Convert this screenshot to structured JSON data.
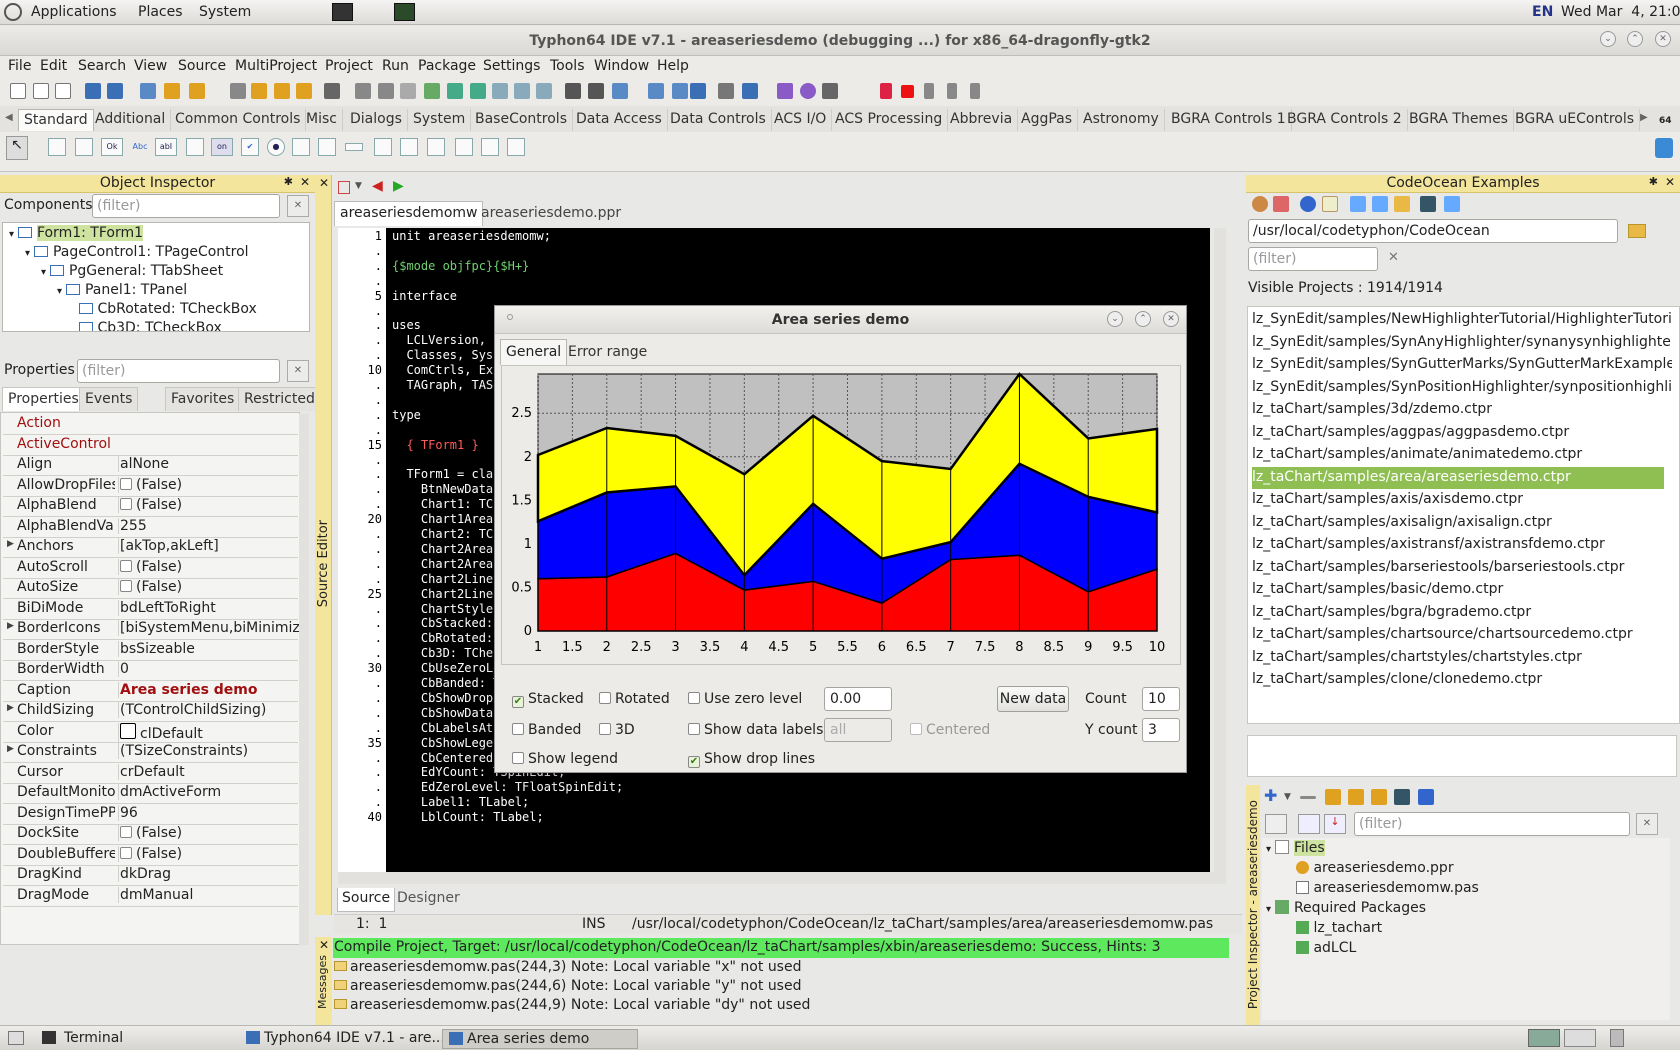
{
  "panel": {
    "menus": [
      "Applications",
      "Places",
      "System"
    ],
    "lang": "EN",
    "clock": "Wed Mar  4, 21:03"
  },
  "window": {
    "title": "Typhon64 IDE v7.1 - areaseriesdemo (debugging ...) for x86_64-dragonfly-gtk2"
  },
  "menu": [
    "File",
    "Edit",
    "Search",
    "View",
    "Source",
    "MultiProject",
    "Project",
    "Run",
    "Package",
    "Settings",
    "Tools",
    "Window",
    "Help"
  ],
  "component_tabs": [
    "Standard",
    "Additional",
    "Common Controls",
    "Misc",
    "Dialogs",
    "System",
    "BaseControls",
    "Data Access",
    "Data Controls",
    "ACS I/O",
    "ACS Processing",
    "Abbrevia",
    "AggPas",
    "Astronomy",
    "BGRA Controls 1",
    "BGRA Controls 2",
    "BGRA Themes",
    "BGRA uEControls"
  ],
  "component_icon_labels": [
    "Ok",
    "Abc",
    "abI",
    "on"
  ],
  "right_toolbar_number": "64",
  "object_inspector": {
    "title": "Object Inspector",
    "components_label": "Components",
    "filter_placeholder": "(filter)",
    "tree": [
      "Form1: TForm1",
      "PageControl1: TPageControl",
      "PgGeneral: TTabSheet",
      "Panel1: TPanel",
      "CbRotated: TCheckBox",
      "Cb3D: TCheckBox"
    ],
    "properties_label": "Properties",
    "tabs": [
      "Properties",
      "Events",
      "Favorites",
      "Restricted"
    ],
    "props": [
      {
        "n": "Action",
        "v": "",
        "red": true
      },
      {
        "n": "ActiveControl",
        "v": "",
        "red": true
      },
      {
        "n": "Align",
        "v": "alNone"
      },
      {
        "n": "AllowDropFiles",
        "v": "(False)",
        "cb": true
      },
      {
        "n": "AlphaBlend",
        "v": "(False)",
        "cb": true
      },
      {
        "n": "AlphaBlendValue",
        "v": "255"
      },
      {
        "n": "Anchors",
        "v": "[akTop,akLeft]",
        "exp": true
      },
      {
        "n": "AutoScroll",
        "v": "(False)",
        "cb": true
      },
      {
        "n": "AutoSize",
        "v": "(False)",
        "cb": true
      },
      {
        "n": "BiDiMode",
        "v": "bdLeftToRight"
      },
      {
        "n": "BorderIcons",
        "v": "[biSystemMenu,biMinimize,",
        "exp": true
      },
      {
        "n": "BorderStyle",
        "v": "bsSizeable"
      },
      {
        "n": "BorderWidth",
        "v": "0"
      },
      {
        "n": "Caption",
        "v": "Area series demo",
        "bold": true
      },
      {
        "n": "ChildSizing",
        "v": "(TControlChildSizing)",
        "exp": true
      },
      {
        "n": "Color",
        "v": "clDefault",
        "sw": true
      },
      {
        "n": "Constraints",
        "v": "(TSizeConstraints)",
        "exp": true
      },
      {
        "n": "Cursor",
        "v": "crDefault"
      },
      {
        "n": "DefaultMonitor",
        "v": "dmActiveForm"
      },
      {
        "n": "DesignTimePPI",
        "v": "96"
      },
      {
        "n": "DockSite",
        "v": "(False)",
        "cb": true
      },
      {
        "n": "DoubleBuffered",
        "v": "(False)",
        "cb": true
      },
      {
        "n": "DragKind",
        "v": "dkDrag"
      },
      {
        "n": "DragMode",
        "v": "dmManual"
      }
    ]
  },
  "editor": {
    "vertical_label": "Source Editor",
    "tabs": [
      "areaseriesdemomw",
      "areaseriesdemo.ppr"
    ],
    "gutter": [
      "1",
      ".",
      ".",
      ".",
      "5",
      ".",
      ".",
      ".",
      ".",
      "10",
      ".",
      ".",
      ".",
      ".",
      "15",
      ".",
      ".",
      ".",
      ".",
      "20",
      ".",
      ".",
      ".",
      ".",
      "25",
      ".",
      ".",
      ".",
      ".",
      "30",
      ".",
      ".",
      ".",
      ".",
      "35",
      ".",
      ".",
      ".",
      ".",
      "40"
    ],
    "lines": [
      {
        "t": "unit areaseriesdemomw;",
        "c": "#ffffff"
      },
      {
        "t": "",
        "c": "#ffffff"
      },
      {
        "t": "{$mode objfpc}{$H+}",
        "c": "#6fd16f"
      },
      {
        "t": "",
        "c": "#ffffff"
      },
      {
        "t": "interface",
        "c": "#ffffff"
      },
      {
        "t": "",
        "c": "#ffffff"
      },
      {
        "t": "uses",
        "c": "#ffffff"
      },
      {
        "t": "  LCLVersion,",
        "c": "#ffffff"
      },
      {
        "t": "  Classes, SysU",
        "c": "#ffffff"
      },
      {
        "t": "  ComCtrls, Ext",
        "c": "#ffffff"
      },
      {
        "t": "  TAGraph, TASe",
        "c": "#ffffff"
      },
      {
        "t": "",
        "c": "#ffffff"
      },
      {
        "t": "type",
        "c": "#ffffff"
      },
      {
        "t": "",
        "c": "#ffffff"
      },
      {
        "t": "  { TForm1 }",
        "c": "#ff5a5a"
      },
      {
        "t": "",
        "c": "#ffffff"
      },
      {
        "t": "  TForm1 = clas",
        "c": "#ffffff"
      },
      {
        "t": "    BtnNewData:",
        "c": "#ffffff"
      },
      {
        "t": "    Chart1: TCh",
        "c": "#ffffff"
      },
      {
        "t": "    Chart1AreaS",
        "c": "#ffffff"
      },
      {
        "t": "    Chart2: TCh",
        "c": "#ffffff"
      },
      {
        "t": "    Chart2AreaS",
        "c": "#ffffff"
      },
      {
        "t": "    Chart2AreaS",
        "c": "#ffffff"
      },
      {
        "t": "    Chart2LineS",
        "c": "#ffffff"
      },
      {
        "t": "    Chart2LineS",
        "c": "#ffffff"
      },
      {
        "t": "    ChartStyles",
        "c": "#ffffff"
      },
      {
        "t": "    CbStacked:",
        "c": "#ffffff"
      },
      {
        "t": "    CbRotated:",
        "c": "#ffffff"
      },
      {
        "t": "    Cb3D: TChec",
        "c": "#ffffff"
      },
      {
        "t": "    CbUseZeroLe",
        "c": "#ffffff"
      },
      {
        "t": "    CbBanded: T",
        "c": "#ffffff"
      },
      {
        "t": "    CbShowDropL",
        "c": "#ffffff"
      },
      {
        "t": "    CbShowDataL",
        "c": "#ffffff"
      },
      {
        "t": "    CbLabelsAt:",
        "c": "#ffffff"
      },
      {
        "t": "    CbShowLegend: TCheckBox;",
        "c": "#ffffff"
      },
      {
        "t": "    CbCentered: TCheckBox;",
        "c": "#ffffff"
      },
      {
        "t": "    EdYCount: TSpinEdit;",
        "c": "#ffffff"
      },
      {
        "t": "    EdZeroLevel: TFloatSpinEdit;",
        "c": "#ffffff"
      },
      {
        "t": "    Label1: TLabel;",
        "c": "#ffffff"
      },
      {
        "t": "    LblCount: TLabel;",
        "c": "#ffffff"
      }
    ],
    "bottom_tabs": [
      "Source",
      "Designer"
    ],
    "status": {
      "pos": "1:  1",
      "mode": "INS",
      "file": "/usr/local/codetyphon/CodeOcean/lz_taChart/samples/area/areaseriesdemomw.pas"
    }
  },
  "messages": {
    "vertical_label": "Messages",
    "compile": "Compile Project, Target: /usr/local/codetyphon/CodeOcean/lz_taChart/samples/xbin/areaseriesdemo: Success, Hints: 3",
    "notes": [
      "areaseriesdemomw.pas(244,3) Note: Local variable \"x\" not used",
      "areaseriesdemomw.pas(244,6) Note: Local variable \"y\" not used",
      "areaseriesdemomw.pas(244,9) Note: Local variable \"dy\" not used"
    ]
  },
  "dialog": {
    "title": "Area series demo",
    "tabs": [
      "General",
      "Error range"
    ],
    "controls": {
      "stacked": "Stacked",
      "rotated": "Rotated",
      "use_zero_level": "Use zero level",
      "zero_level": "0.00",
      "new_data": "New data",
      "count_label": "Count",
      "count": "10",
      "banded": "Banded",
      "three_d": "3D",
      "show_data_labels": "Show data labels",
      "labels_select": "all",
      "centered": "Centered",
      "ycount_label": "Y count",
      "ycount": "3",
      "show_legend": "Show legend",
      "show_drop_lines": "Show drop lines"
    }
  },
  "chart_data": {
    "type": "area",
    "stacked": true,
    "x": [
      1,
      2,
      3,
      4,
      5,
      6,
      7,
      8,
      9,
      10
    ],
    "xticks": [
      "1",
      "1.5",
      "2",
      "2.5",
      "3",
      "3.5",
      "4",
      "4.5",
      "5",
      "5.5",
      "6",
      "6.5",
      "7",
      "7.5",
      "8",
      "8.5",
      "9",
      "9.5",
      "10"
    ],
    "yticks": [
      "0",
      "0.5",
      "1",
      "1.5",
      "2",
      "2.5"
    ],
    "ylim": [
      0,
      2.95
    ],
    "xlim": [
      1,
      10
    ],
    "grid": true,
    "series": [
      {
        "values": [
          0.6,
          0.62,
          0.89,
          0.47,
          0.57,
          0.32,
          0.82,
          0.87,
          0.45,
          0.71
        ],
        "color": "#ff0000"
      },
      {
        "values": [
          0.66,
          0.97,
          0.77,
          0.17,
          0.89,
          0.51,
          0.2,
          1.05,
          1.09,
          0.65
        ],
        "color": "#0000ff"
      },
      {
        "values": [
          0.76,
          0.74,
          0.58,
          1.16,
          1.01,
          1.12,
          0.84,
          1.03,
          0.67,
          0.96
        ],
        "color": "#ffff00"
      }
    ]
  },
  "codeocean": {
    "title": "CodeOcean Examples",
    "path": "/usr/local/codetyphon/CodeOcean",
    "filter_placeholder": "(filter)",
    "visible": "Visible Projects : 1914/1914",
    "items": [
      "lz_SynEdit/samples/NewHighlighterTutorial/HighlighterTutorial.ctpr",
      "lz_SynEdit/samples/SynAnyHighlighter/synanysynhighlighter.ctpr",
      "lz_SynEdit/samples/SynGutterMarks/SynGutterMarkExample.ctpr",
      "lz_SynEdit/samples/SynPositionHighlighter/synpositionhighlighter.ctpr",
      "lz_taChart/samples/3d/zdemo.ctpr",
      "lz_taChart/samples/aggpas/aggpasdemo.ctpr",
      "lz_taChart/samples/animate/animatedemo.ctpr",
      "lz_taChart/samples/area/areaseriesdemo.ctpr",
      "lz_taChart/samples/axis/axisdemo.ctpr",
      "lz_taChart/samples/axisalign/axisalign.ctpr",
      "lz_taChart/samples/axistransf/axistransfdemo.ctpr",
      "lz_taChart/samples/barseriestools/barseriestools.ctpr",
      "lz_taChart/samples/basic/demo.ctpr",
      "lz_taChart/samples/bgra/bgrademo.ctpr",
      "lz_taChart/samples/chartsource/chartsourcedemo.ctpr",
      "lz_taChart/samples/chartstyles/chartstyles.ctpr",
      "lz_taChart/samples/clone/clonedemo.ctpr"
    ],
    "selected_index": 7
  },
  "project_inspector": {
    "vertical_label": "Project Inspector - areaseriesdemo",
    "filter_placeholder": "(filter)",
    "files_label": "Files",
    "files": [
      "areaseriesdemo.ppr",
      "areaseriesdemomw.pas"
    ],
    "required_label": "Required Packages",
    "packages": [
      "lz_tachart",
      "adLCL"
    ]
  },
  "taskbar": [
    "Terminal",
    "Typhon64 IDE v7.1 - are...",
    "Area series demo"
  ]
}
